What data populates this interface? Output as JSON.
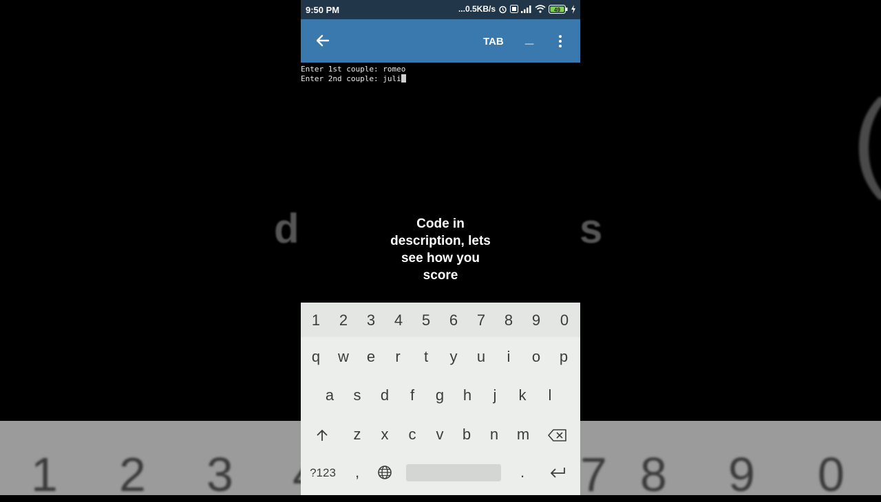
{
  "status_bar": {
    "time": "9:50 PM",
    "network_speed": "...0.5KB/s",
    "battery": "49"
  },
  "app_bar": {
    "tab_label": "TAB",
    "minimize_label": "_"
  },
  "terminal": {
    "lines": [
      "Enter 1st couple: romeo",
      "Enter 2nd couple: juli"
    ]
  },
  "caption": {
    "line1": "Code in",
    "line2": "description, lets",
    "line3": "see how you",
    "line4": "score"
  },
  "keyboard": {
    "number_row": [
      "1",
      "2",
      "3",
      "4",
      "5",
      "6",
      "7",
      "8",
      "9",
      "0"
    ],
    "row1": [
      "q",
      "w",
      "e",
      "r",
      "t",
      "y",
      "u",
      "i",
      "o",
      "p"
    ],
    "row2": [
      "a",
      "s",
      "d",
      "f",
      "g",
      "h",
      "j",
      "k",
      "l"
    ],
    "row3": [
      "z",
      "x",
      "c",
      "v",
      "b",
      "n",
      "m"
    ],
    "symbols_label": "?123",
    "comma": ",",
    "period": "."
  },
  "background": {
    "digits": [
      "1",
      "2",
      "3",
      "4",
      "7",
      "8",
      "9",
      "0"
    ],
    "letter_left": "d",
    "letter_right": "s",
    "paren": "("
  }
}
